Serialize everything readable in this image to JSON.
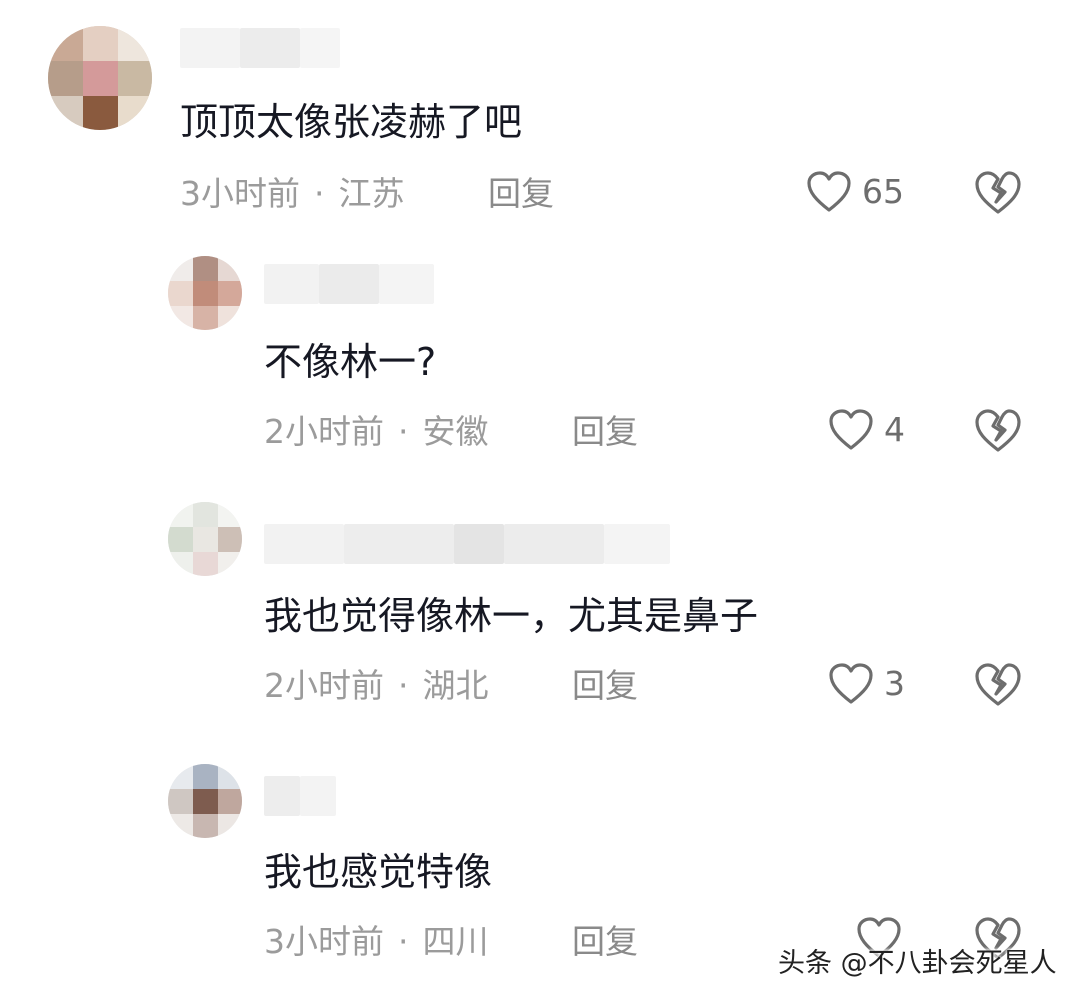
{
  "comments": [
    {
      "text": "顶顶太像张凌赫了吧",
      "time": "3小时前",
      "dot": "·",
      "location": "江苏",
      "reply_label": "回复",
      "likes": "65",
      "is_reply": false
    },
    {
      "text": "不像林一?",
      "time": "2小时前",
      "dot": "·",
      "location": "安徽",
      "reply_label": "回复",
      "likes": "4",
      "is_reply": true
    },
    {
      "text": "我也觉得像林一，尤其是鼻子",
      "time": "2小时前",
      "dot": "·",
      "location": "湖北",
      "reply_label": "回复",
      "likes": "3",
      "is_reply": true
    },
    {
      "text": "我也感觉特像",
      "time": "3小时前",
      "dot": "·",
      "location": "四川",
      "reply_label": "回复",
      "likes": "",
      "is_reply": true
    }
  ],
  "watermark": "头条 @不八卦会死星人",
  "icons": {
    "like": "heart-outline-icon",
    "dislike": "broken-heart-icon"
  },
  "colors": {
    "text": "#161823",
    "meta": "#9b9b9b",
    "icon": "#6d6d6d"
  }
}
